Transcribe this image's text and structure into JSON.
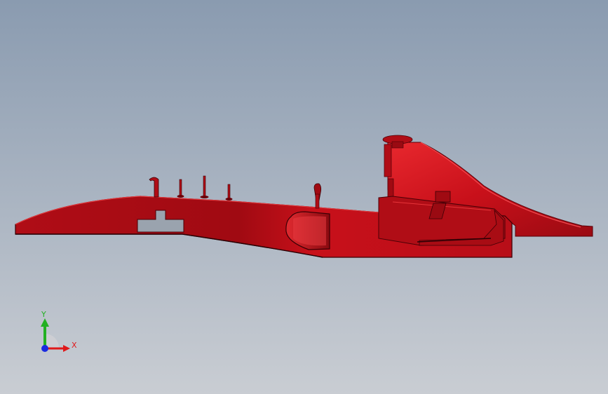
{
  "viewport": {
    "background_top": "#8a9bb0",
    "background_bottom": "#c9cdd3"
  },
  "model": {
    "name": "red-body-part",
    "color": "#c8101a",
    "shadow_color": "#8a0a10",
    "highlight_color": "#e8282e",
    "edge_color": "#3a0005"
  },
  "triad": {
    "x_label": "X",
    "y_label": "Y",
    "x_color": "#e0181a",
    "y_color": "#22b022",
    "z_color": "#1a2ae0"
  }
}
